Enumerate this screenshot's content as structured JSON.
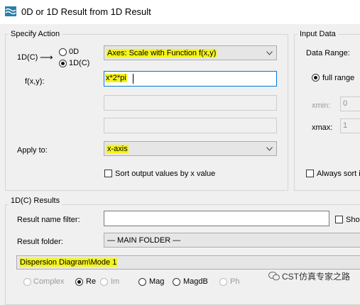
{
  "window": {
    "title": "0D or 1D Result from 1D Result"
  },
  "specify_action": {
    "legend": "Specify Action",
    "dimension_label": "1D(C)",
    "arrow": "⟶",
    "radio_0d": "0D",
    "radio_1dc": "1D(C)",
    "selected_radio": "1D(C)",
    "action_value": "Axes: Scale with Function f(x,y)",
    "fxy_label": "f(x,y):",
    "fxy_value": "x*2*pi",
    "apply_to_label": "Apply to:",
    "apply_to_value": "x-axis",
    "sort_label": "Sort output values by x value"
  },
  "input_data": {
    "legend": "Input Data",
    "data_range_label": "Data Range:",
    "full_range_label": "full range",
    "xmin_label": "xmin:",
    "xmin_value": "0",
    "xmax_label": "xmax:",
    "xmax_value": "1",
    "always_sort_label": "Always sort i"
  },
  "results": {
    "legend": "1D(C) Results",
    "name_filter_label": "Result name filter:",
    "name_filter_value": "",
    "show_label": "Sho",
    "folder_label": "Result folder:",
    "folder_value": "— MAIN FOLDER —",
    "selected_result": "Dispersion Diagram\\Mode 1",
    "components": [
      {
        "label": "Complex",
        "selected": false,
        "enabled": false
      },
      {
        "label": "Re",
        "selected": true,
        "enabled": true
      },
      {
        "label": "Im",
        "selected": false,
        "enabled": false
      },
      {
        "label": "Mag",
        "selected": false,
        "enabled": true
      },
      {
        "label": "MagdB",
        "selected": false,
        "enabled": true
      },
      {
        "label": "Ph",
        "selected": false,
        "enabled": false
      }
    ]
  },
  "watermark": {
    "text": "CST仿真专家之路"
  },
  "colors": {
    "highlight": "#f4f41a",
    "focus_border": "#0078d7",
    "background": "#f0f0f0"
  }
}
